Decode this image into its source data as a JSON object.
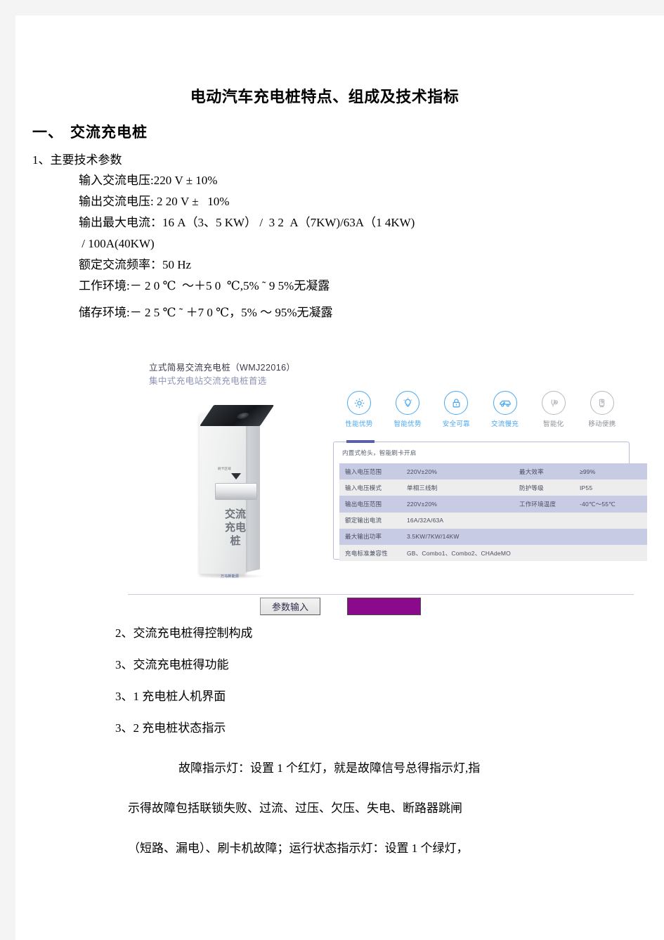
{
  "document": {
    "title": "电动汽车充电桩特点、组成及技术指标",
    "section1": {
      "number": "一、",
      "heading": "交流充电桩"
    },
    "params": {
      "label": "1、主要技术参数",
      "lines": [
        "输入交流电压:220 V ± 10%",
        "输出交流电压: 2 20 V ±   10%",
        "输出最大电流：16 A（3、5 KW） /  3 2  A（7KW)/63A（1 4KW)",
        " / 100A(40KW)",
        "额定交流频率：50 Hz",
        "工作环境:－ 2 0 ℃  ～＋5 0  ℃,5% ˜ 9 5%无凝露",
        "储存环境:－ 2 5 ℃ ˜ ＋7 0 ℃，5% ～ 95%无凝露"
      ]
    },
    "figure": {
      "title": "立式简易交流充电桩（WMJ22016）",
      "subtitle": "集中式充电站交流充电桩首选",
      "device": {
        "slot_label": "刷卡区域",
        "vertical_text": "交流充电桩",
        "logo_text": "万马新能源"
      },
      "icons": [
        {
          "name": "gear-icon",
          "label": "性能优势",
          "color": "#4aa8f0"
        },
        {
          "name": "bulb-icon",
          "label": "智能优势",
          "color": "#4aa8f0"
        },
        {
          "name": "lock-icon",
          "label": "安全可靠",
          "color": "#4aa8f0"
        },
        {
          "name": "car-icon",
          "label": "交流慢充",
          "color": "#4aa8f0"
        },
        {
          "name": "smart-charge-icon",
          "label": "智能化",
          "color": "#8c9096"
        },
        {
          "name": "portable-icon",
          "label": "移动便携",
          "color": "#8c9096"
        }
      ],
      "spec_caption": "内置式枪头，智能刷卡开启",
      "spec_rows": [
        {
          "k1": "输入电压范围",
          "v1": "220V±20%",
          "k2": "最大效率",
          "v2": "≥99%"
        },
        {
          "k1": "输入电压模式",
          "v1": "单相三线制",
          "k2": "防护等级",
          "v2": "IP55"
        },
        {
          "k1": "输出电压范围",
          "v1": "220V±20%",
          "k2": "工作环境温度",
          "v2": "-40℃～55℃"
        },
        {
          "k1": "额定输出电流",
          "v1": "16A/32A/63A",
          "k2": "",
          "v2": ""
        },
        {
          "k1": "最大输出功率",
          "v1": "3.5KW/7KW/14KW",
          "k2": "",
          "v2": ""
        },
        {
          "k1": "充电标准兼容性",
          "v1": "GB、Combo1、Combo2、CHAdeMO",
          "k2": "",
          "v2": ""
        }
      ],
      "param_button": "参数输入",
      "purple_box_color": "#8b0a8b",
      "green_marker_color": "#22ee22"
    },
    "list": [
      "2、交流充电桩得控制构成",
      "3、交流充电桩得功能",
      "3、1 充电桩人机界面",
      "3、2 充电桩状态指示"
    ],
    "paragraph": [
      "故障指示灯：设置 1 个红灯，就是故障信号总得指示灯,指",
      "示得故障包括联锁失败、过流、过压、欠压、失电、断路器跳闸",
      "（短路、漏电）、刷卡机故障；运行状态指示灯：设置 1 个绿灯，"
    ]
  }
}
